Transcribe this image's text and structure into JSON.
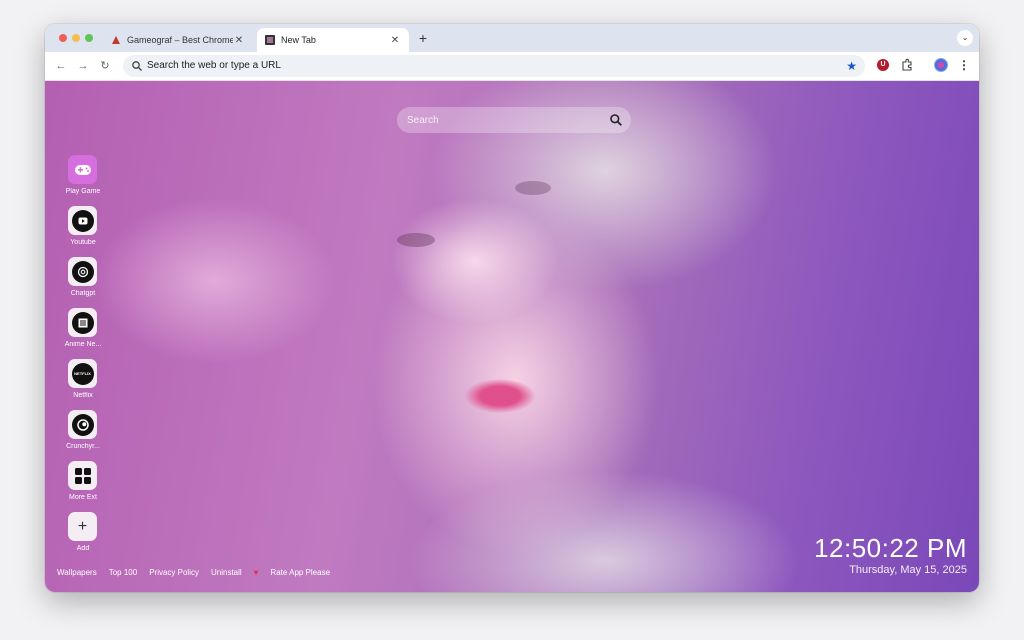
{
  "tabs": [
    {
      "title": "Gameograf – Best Chrome Li",
      "active": false
    },
    {
      "title": "New Tab",
      "active": true
    }
  ],
  "toolbar": {
    "omnibox_text": "Search the web or type a URL"
  },
  "search": {
    "placeholder": "Search"
  },
  "shortcuts": [
    {
      "label": "Play Game",
      "icon": "gamepad-icon"
    },
    {
      "label": "Youtube",
      "icon": "youtube-icon"
    },
    {
      "label": "Chatgpt",
      "icon": "chatgpt-icon"
    },
    {
      "label": "Anime Ne...",
      "icon": "anime-news-icon"
    },
    {
      "label": "Netflix",
      "icon": "netflix-icon"
    },
    {
      "label": "Crunchyr...",
      "icon": "crunchyroll-icon"
    },
    {
      "label": "More Ext",
      "icon": "more-extensions-icon"
    },
    {
      "label": "Add",
      "icon": "plus-icon"
    }
  ],
  "footer": {
    "links": [
      "Wallpapers",
      "Top 100",
      "Privacy Policy",
      "Uninstall"
    ],
    "rate": "Rate App Please"
  },
  "clock": {
    "time": "12:50:22 PM",
    "date": "Thursday, May 15, 2025"
  },
  "colors": {
    "accent_star": "#1a56c7",
    "heart": "#e0304c",
    "ext_badge": "#b21c2e"
  }
}
